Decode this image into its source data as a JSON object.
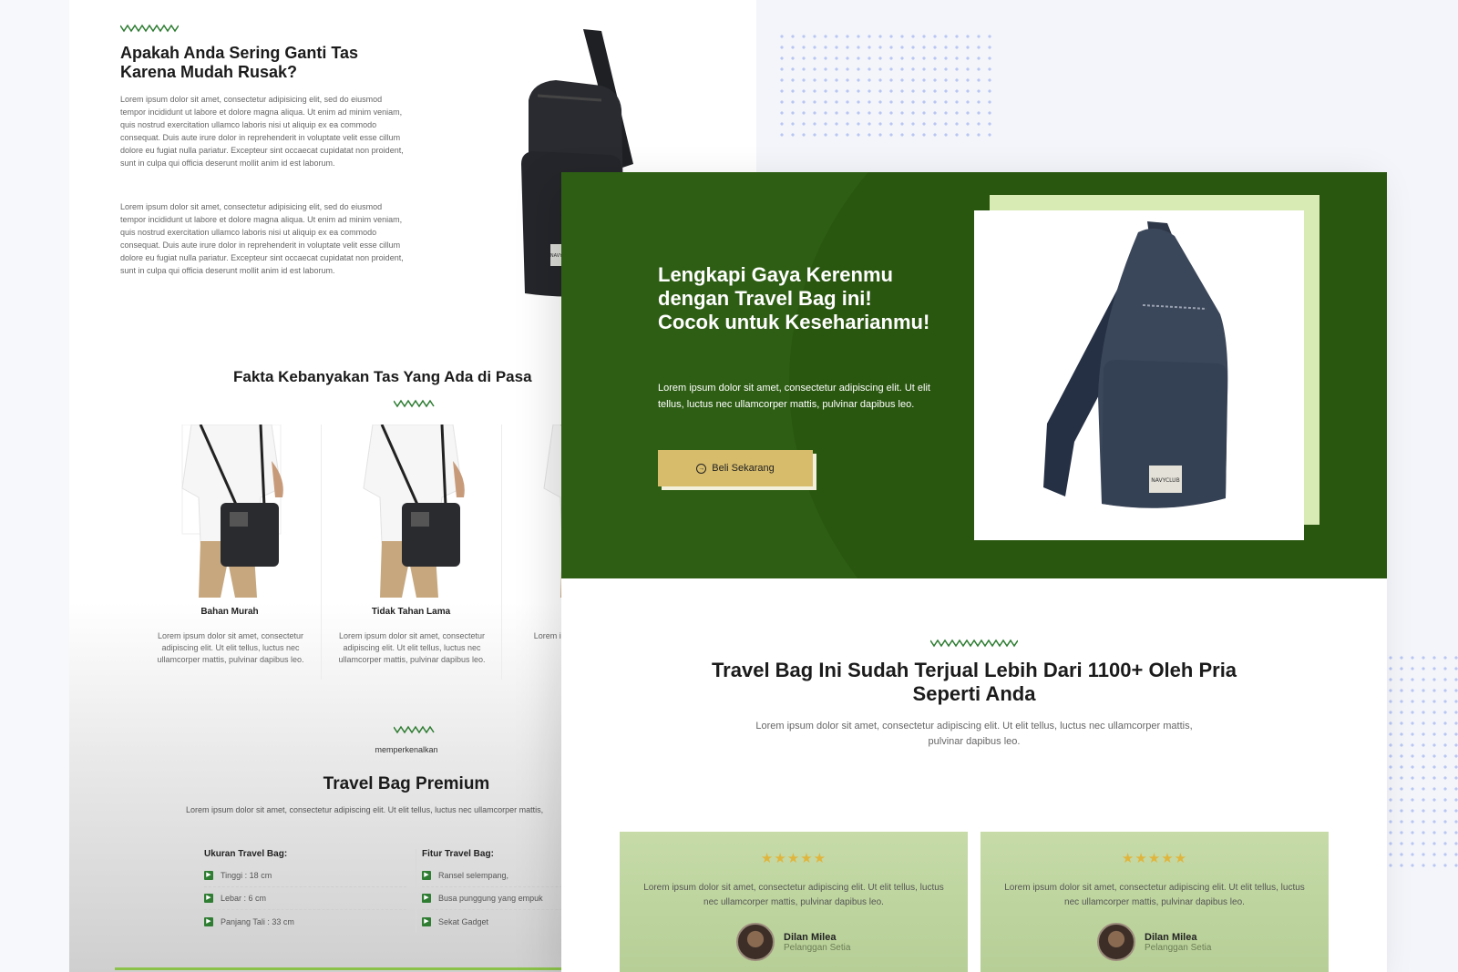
{
  "colors": {
    "hero_green": "#2e5e14",
    "accent_gold": "#d7bc6b",
    "light_green": "#d9ebb5",
    "card_green": "#c6dba8",
    "star_color": "#e0b53c",
    "zigzag_green": "#2e7d32"
  },
  "back_page": {
    "intro_title": "Apakah Anda Sering Ganti Tas Karena Mudah Rusak?",
    "intro_para_1": "Lorem ipsum dolor sit amet, consectetur adipisicing elit, sed do eiusmod tempor incididunt ut labore et dolore magna aliqua. Ut enim ad minim veniam, quis nostrud exercitation ullamco laboris nisi ut aliquip ex ea commodo consequat. Duis aute irure dolor in reprehenderit in voluptate velit esse cillum dolore eu fugiat nulla pariatur. Excepteur sint occaecat cupidatat non proident, sunt in culpa qui officia deserunt mollit anim id est laborum.",
    "intro_para_2": "Lorem ipsum dolor sit amet, consectetur adipisicing elit, sed do eiusmod tempor incididunt ut labore et dolore magna aliqua. Ut enim ad minim veniam, quis nostrud exercitation ullamco laboris nisi ut aliquip ex ea commodo consequat. Duis aute irure dolor in reprehenderit in voluptate velit esse cillum dolore eu fugiat nulla pariatur. Excepteur sint occaecat cupidatat non proident, sunt in culpa qui officia deserunt mollit anim id est laborum.",
    "bag_label": "NAVYCLUB",
    "facts_title": "Fakta Kebanyakan Tas Yang Ada di Pasa",
    "facts": [
      {
        "title": "Bahan Murah",
        "text": "Lorem ipsum dolor sit amet, consectetur adipiscing elit. Ut elit tellus, luctus nec ullamcorper mattis, pulvinar dapibus leo."
      },
      {
        "title": "Tidak Tahan Lama",
        "text": "Lorem ipsum dolor sit amet, consectetur adipiscing elit. Ut elit tellus, luctus nec ullamcorper mattis, pulvinar dapibus leo."
      },
      {
        "title": "",
        "text": "Lorem ipsu adipiscin ullamcorpe"
      }
    ],
    "premium_kicker": "memperkenalkan",
    "premium_title": "Travel Bag Premium",
    "premium_text": "Lorem ipsum dolor sit amet, consectetur adipiscing elit. Ut elit tellus, luctus nec ullamcorper mattis,",
    "size_head": "Ukuran Travel Bag:",
    "sizes": [
      "Tinggi : 18 cm",
      "Lebar : 6 cm",
      "Panjang Tali : 33 cm"
    ],
    "feature_head": "Fitur Travel Bag:",
    "features": [
      "Ransel selempang,",
      "Busa punggung yang empuk",
      "Sekat Gadget"
    ]
  },
  "hero": {
    "title": "Lengkapi Gaya Kerenmu dengan Travel Bag ini! Cocok untuk Keseharianmu!",
    "text": "Lorem ipsum dolor sit amet, consectetur adipiscing elit. Ut elit tellus, luctus nec ullamcorper mattis, pulvinar dapibus leo.",
    "button_label": "Beli Sekarang",
    "bag_label": "NAVYCLUB"
  },
  "sold": {
    "title": "Travel Bag Ini Sudah Terjual Lebih Dari 1100+ Oleh Pria Seperti Anda",
    "text": "Lorem ipsum dolor sit amet, consectetur adipiscing elit. Ut elit tellus, luctus nec ullamcorper mattis, pulvinar dapibus leo."
  },
  "testimonials": [
    {
      "stars": "★★★★★",
      "text": "Lorem ipsum dolor sit amet, consectetur adipiscing elit. Ut elit tellus, luctus nec ullamcorper mattis, pulvinar dapibus leo.",
      "name": "Dilan Milea",
      "role": "Pelanggan Setia"
    },
    {
      "stars": "★★★★★",
      "text": "Lorem ipsum dolor sit amet, consectetur adipiscing elit. Ut elit tellus, luctus nec ullamcorper mattis, pulvinar dapibus leo.",
      "name": "Dilan Milea",
      "role": "Pelanggan Setia"
    }
  ]
}
